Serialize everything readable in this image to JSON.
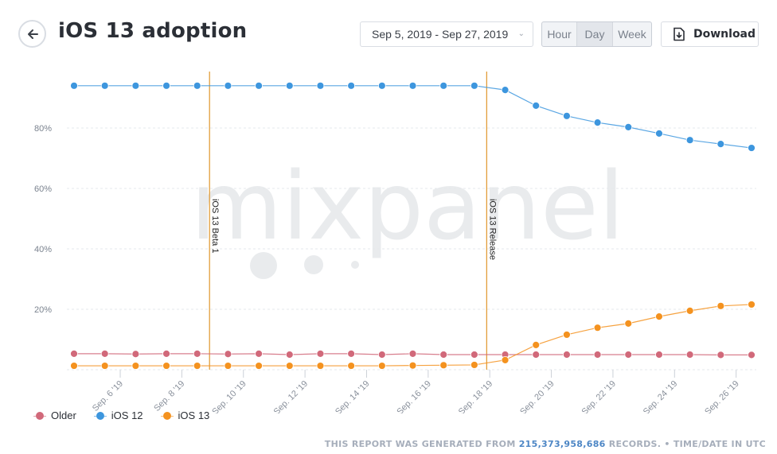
{
  "header": {
    "title": "iOS 13 adoption",
    "back_icon": "arrow-left-icon",
    "date_range": "Sep 5, 2019 - Sep 27, 2019",
    "date_range_icon": "chevron-down-icon",
    "granularity": [
      {
        "label": "Hour",
        "active": false
      },
      {
        "label": "Day",
        "active": true
      },
      {
        "label": "Week",
        "active": false
      }
    ],
    "download_label": "Download",
    "download_icon": "file-download-icon"
  },
  "watermark": "mixpanel",
  "footer": {
    "prefix": "THIS REPORT WAS GENERATED FROM ",
    "records": "215,373,958,686",
    "suffix": " RECORDS. • TIME/DATE IN UTC"
  },
  "chart_data": {
    "type": "line",
    "title": "iOS 13 adoption",
    "xlabel": "",
    "ylabel": "",
    "ylim": [
      0,
      100
    ],
    "y_ticks": [
      20,
      40,
      60,
      80
    ],
    "y_tick_labels": [
      "20%",
      "40%",
      "60%",
      "80%"
    ],
    "grid": true,
    "legend_position": "bottom-left",
    "x": [
      "Sep 5",
      "Sep 6",
      "Sep 7",
      "Sep 8",
      "Sep 9",
      "Sep 10",
      "Sep 11",
      "Sep 12",
      "Sep 13",
      "Sep 14",
      "Sep 15",
      "Sep 16",
      "Sep 17",
      "Sep 18",
      "Sep 19",
      "Sep 20",
      "Sep 21",
      "Sep 22",
      "Sep 23",
      "Sep 24",
      "Sep 25",
      "Sep 26",
      "Sep 27"
    ],
    "x_tick_labels": [
      "Sep. 6 '19",
      "Sep. 8 '19",
      "Sep. 10 '19",
      "Sep. 12 '19",
      "Sep. 14 '19",
      "Sep. 16 '19",
      "Sep. 18 '19",
      "Sep. 20 '19",
      "Sep. 22 '19",
      "Sep. 24 '19",
      "Sep. 26 '19"
    ],
    "x_tick_positions": [
      1.5,
      3.5,
      5.5,
      7.5,
      9.5,
      11.5,
      13.5,
      15.5,
      17.5,
      19.5,
      21.5
    ],
    "series": [
      {
        "name": "Older",
        "color": "#d1697a",
        "values": [
          5.3,
          5.3,
          5.2,
          5.3,
          5.3,
          5.2,
          5.3,
          5.0,
          5.3,
          5.3,
          5.0,
          5.3,
          5.0,
          5.0,
          5.0,
          5.0,
          5.0,
          5.0,
          5.0,
          5.0,
          5.0,
          4.9,
          4.9,
          5.7
        ]
      },
      {
        "name": "iOS 12",
        "color": "#3d96de",
        "values": [
          94.0,
          94.0,
          94.0,
          94.0,
          94.0,
          94.0,
          94.0,
          94.0,
          94.0,
          94.0,
          94.0,
          94.0,
          94.0,
          94.0,
          92.6,
          87.4,
          84.0,
          81.8,
          80.3,
          78.2,
          76.0,
          74.7,
          73.4
        ]
      },
      {
        "name": "iOS 13",
        "color": "#f4921f",
        "values": [
          1.3,
          1.3,
          1.3,
          1.3,
          1.3,
          1.3,
          1.3,
          1.3,
          1.3,
          1.3,
          1.3,
          1.4,
          1.5,
          1.6,
          3.2,
          8.2,
          11.6,
          13.9,
          15.3,
          17.6,
          19.5,
          21.1,
          21.6
        ]
      }
    ],
    "annotations": [
      {
        "label": "iOS 13 Beta 1",
        "x_position": 4.4
      },
      {
        "label": "iOS 13 Release",
        "x_position": 13.4
      }
    ]
  }
}
